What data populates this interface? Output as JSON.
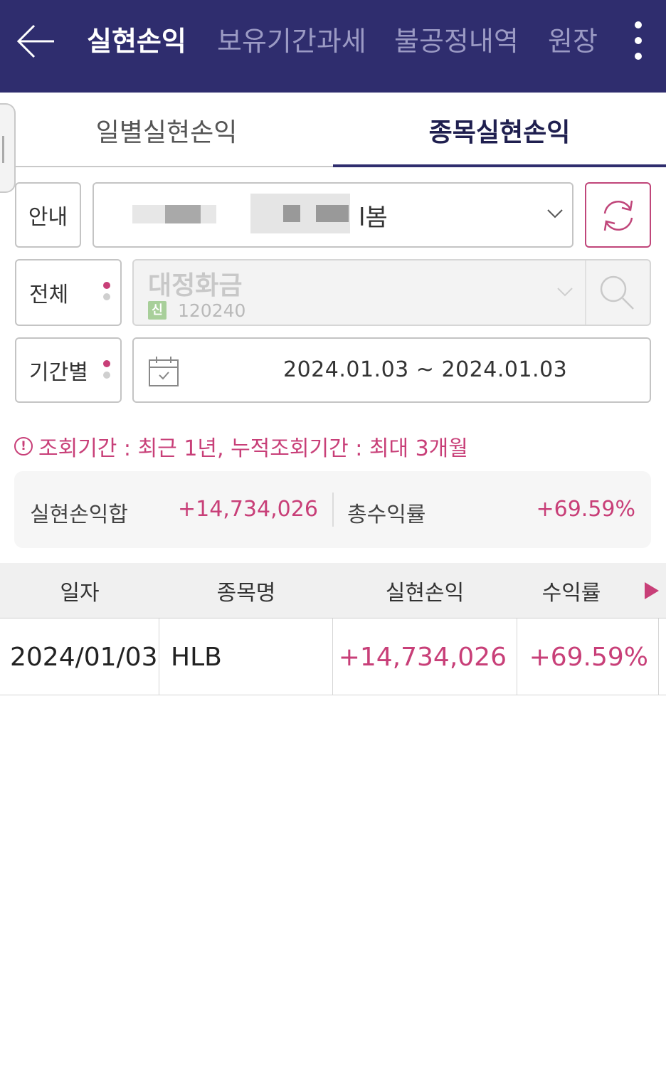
{
  "header": {
    "tabs": [
      {
        "label": "실현손익",
        "active": true
      },
      {
        "label": "보유기간과세",
        "active": false
      },
      {
        "label": "불공정내역",
        "active": false
      },
      {
        "label": "원장",
        "active": false
      }
    ]
  },
  "subtabs": [
    {
      "label": "일별실현손익",
      "active": false
    },
    {
      "label": "종목실현손익",
      "active": true
    }
  ],
  "filters": {
    "guide_label": "안내",
    "account_suffix": "l봄",
    "scope_label": "전체",
    "stock_name": "대정화금",
    "stock_badge": "신",
    "stock_code": "120240",
    "period_label": "기간별",
    "date_range": "2024.01.03 ~ 2024.01.03"
  },
  "notice": {
    "icon": "!",
    "text": "조회기간 : 최근 1년, 누적조회기간 : 최대 3개월"
  },
  "summary": {
    "realized_label": "실현손익합",
    "realized_value": "+14,734,026",
    "rate_label": "총수익률",
    "rate_value": "+69.59%"
  },
  "table": {
    "headers": [
      "일자",
      "종목명",
      "실현손익",
      "수익률"
    ],
    "rows": [
      {
        "date": "2024/01/03",
        "name": "HLB",
        "pnl": "+14,734,026",
        "rate": "+69.59%"
      }
    ]
  },
  "colors": {
    "header_bg": "#2f2d6e",
    "accent_pink": "#c83f78"
  }
}
